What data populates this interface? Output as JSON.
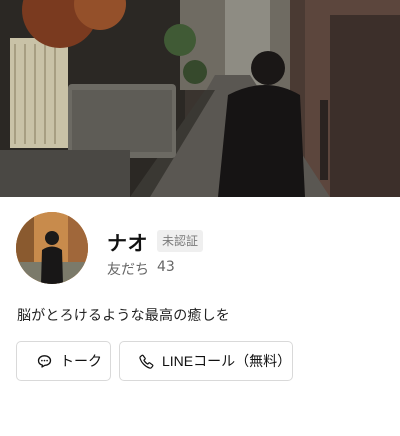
{
  "profile": {
    "name": "ナオ",
    "badge": "未認証",
    "friends_label": "友だち",
    "friends_count": "43",
    "status_message": "脳がとろけるような最高の癒しを"
  },
  "actions": {
    "talk_label": "トーク",
    "call_label": "LINEコール（無料）"
  },
  "icons": {
    "talk": "chat-bubble-icon",
    "call": "phone-icon"
  },
  "colors": {
    "border": "#d9d9d9",
    "badge_bg": "#efefef",
    "muted_text": "#666666"
  }
}
